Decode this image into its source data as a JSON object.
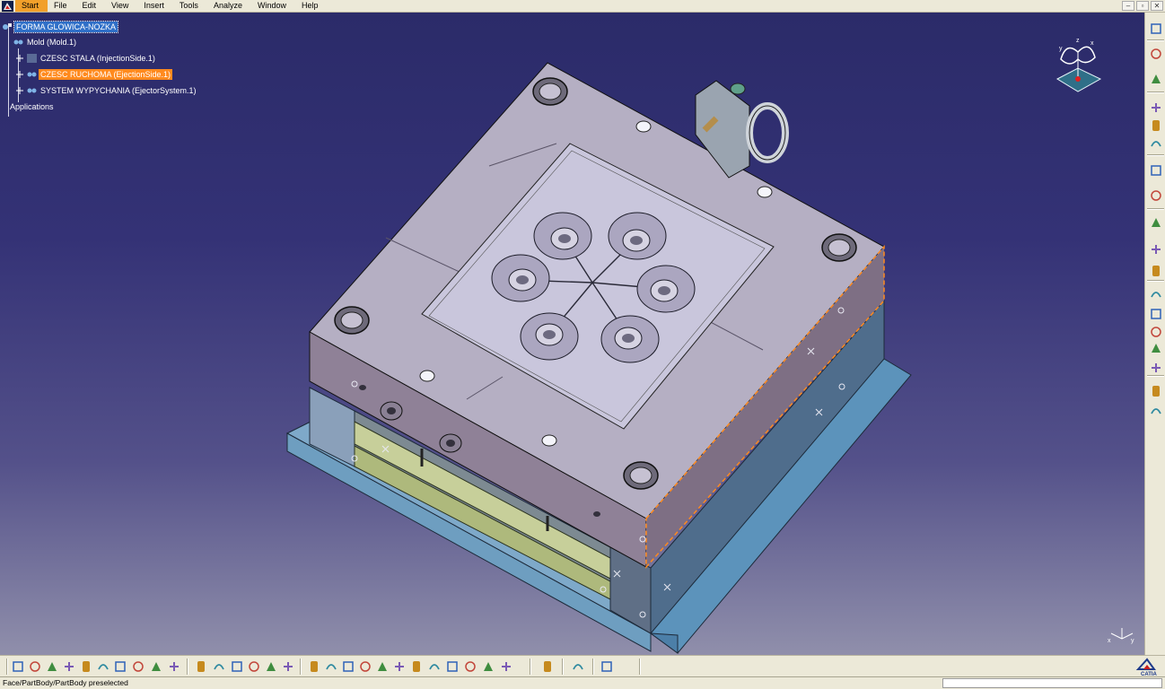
{
  "menu": {
    "items": [
      {
        "label": "Start",
        "active": true
      },
      {
        "label": "File"
      },
      {
        "label": "Edit"
      },
      {
        "label": "View"
      },
      {
        "label": "Insert"
      },
      {
        "label": "Tools"
      },
      {
        "label": "Analyze"
      },
      {
        "label": "Window"
      },
      {
        "label": "Help"
      }
    ]
  },
  "tree": {
    "root": "FORMA GLOWICA-NOZKA",
    "mold": "Mold (Mold.1)",
    "injection": "CZESC STALA (InjectionSide.1)",
    "ejection": "CZESC RUCHOMA (EjectionSide.1)",
    "ejector_system": "SYSTEM WYPYCHANIA (EjectorSystem.1)",
    "applications": "Applications"
  },
  "compass": {
    "axes": [
      "x",
      "y",
      "z"
    ]
  },
  "right_toolbar": {
    "icons": [
      "select-arrow-icon",
      "sketcher-icon",
      "tools-palette-icon",
      "mold-base-icon",
      "insert-plate-icon",
      "plate-icon",
      "component-icon",
      "pin-icon",
      "bushing-icon",
      "ejector-pin-icon",
      "stop-pin-icon",
      "sprue-icon",
      "cooling-channel-icon",
      "gate-icon",
      "runner-icon",
      "slider-icon",
      "split-icon",
      "transform-icon"
    ]
  },
  "bottom_toolbar": {
    "icons": [
      "new-icon",
      "open-icon",
      "save-icon",
      "print-icon",
      "cut-icon",
      "copy-icon",
      "paste-icon",
      "undo-icon",
      "redo-icon",
      "whats-this-icon",
      "formula-icon",
      "comment-icon",
      "knowledge-icon",
      "catalog-icon",
      "measure-icon",
      "apply-material-icon",
      "fly-mode-icon",
      "fit-all-icon",
      "pan-icon",
      "rotate-icon",
      "zoom-in-icon",
      "zoom-out-icon",
      "normal-view-icon",
      "quick-view-icon",
      "view-mode-icon",
      "hide-show-icon",
      "swap-space-icon",
      "analysis-icon",
      "update-icon",
      "product-icon",
      "constraints-icon"
    ]
  },
  "statusbar": {
    "text": "Face/PartBody/PartBody preselected"
  },
  "colors": {
    "viewport_top": "#2b2b69",
    "viewport_bottom": "#908fab",
    "mold_top": "#b6b0c4",
    "mold_side": "#8e7f94",
    "plate_blue": "#6b9fc2",
    "ejector_plate": "#b9c48e",
    "selection_orange": "#ff8a1e",
    "selection_blue": "#3070c8"
  }
}
